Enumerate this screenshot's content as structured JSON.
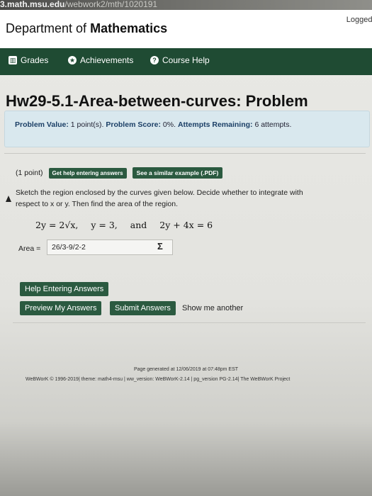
{
  "browser": {
    "url_visible": "3.math.msu.edu",
    "url_faded": "/webwork2/mth/1020191"
  },
  "header": {
    "department": "Department of",
    "department_bold": "Mathematics",
    "logged_in": "Logged i"
  },
  "nav": {
    "items": [
      {
        "label": "Grades"
      },
      {
        "label": "Achievements"
      },
      {
        "label": "Course Help"
      }
    ]
  },
  "problem": {
    "title": "Hw29-5.1-Area-between-curves: Problem",
    "value_label": "Problem Value:",
    "value": "1 point(s).",
    "score_label": "Problem Score:",
    "score": "0%.",
    "attempts_label": "Attempts Remaining:",
    "attempts": "6 attempts.",
    "points": "(1 point)",
    "help_button": "Get help entering answers",
    "similar_button": "See a similar example (.PDF)",
    "prompt_line1": "Sketch the region enclosed by the curves given below. Decide whether to integrate with",
    "prompt_line2": "respect to x or y. Then find the area of the region.",
    "eq1": "2y = 2√x,",
    "eq2": "y = 3,",
    "eq_and": "and",
    "eq3": "2y + 4x = 6",
    "answer_label": "Area =",
    "answer_value": "26/3-9/2-2",
    "sigma": "Σ"
  },
  "buttons": {
    "help_entering": "Help Entering Answers",
    "preview": "Preview My Answers",
    "submit": "Submit Answers",
    "show_another": "Show me another"
  },
  "footer": {
    "generated": "Page generated at 12/06/2019 at 07:48pm EST",
    "credits": "WeBWorK © 1996-2019| theme: math4-msu | ww_version: WeBWorK-2.14 | pg_version PG-2.14| The WeBWorK Project"
  },
  "colors": {
    "nav_green": "#1f4b33",
    "button_green": "#2b5a40",
    "info_box": "#d9e8ee"
  }
}
